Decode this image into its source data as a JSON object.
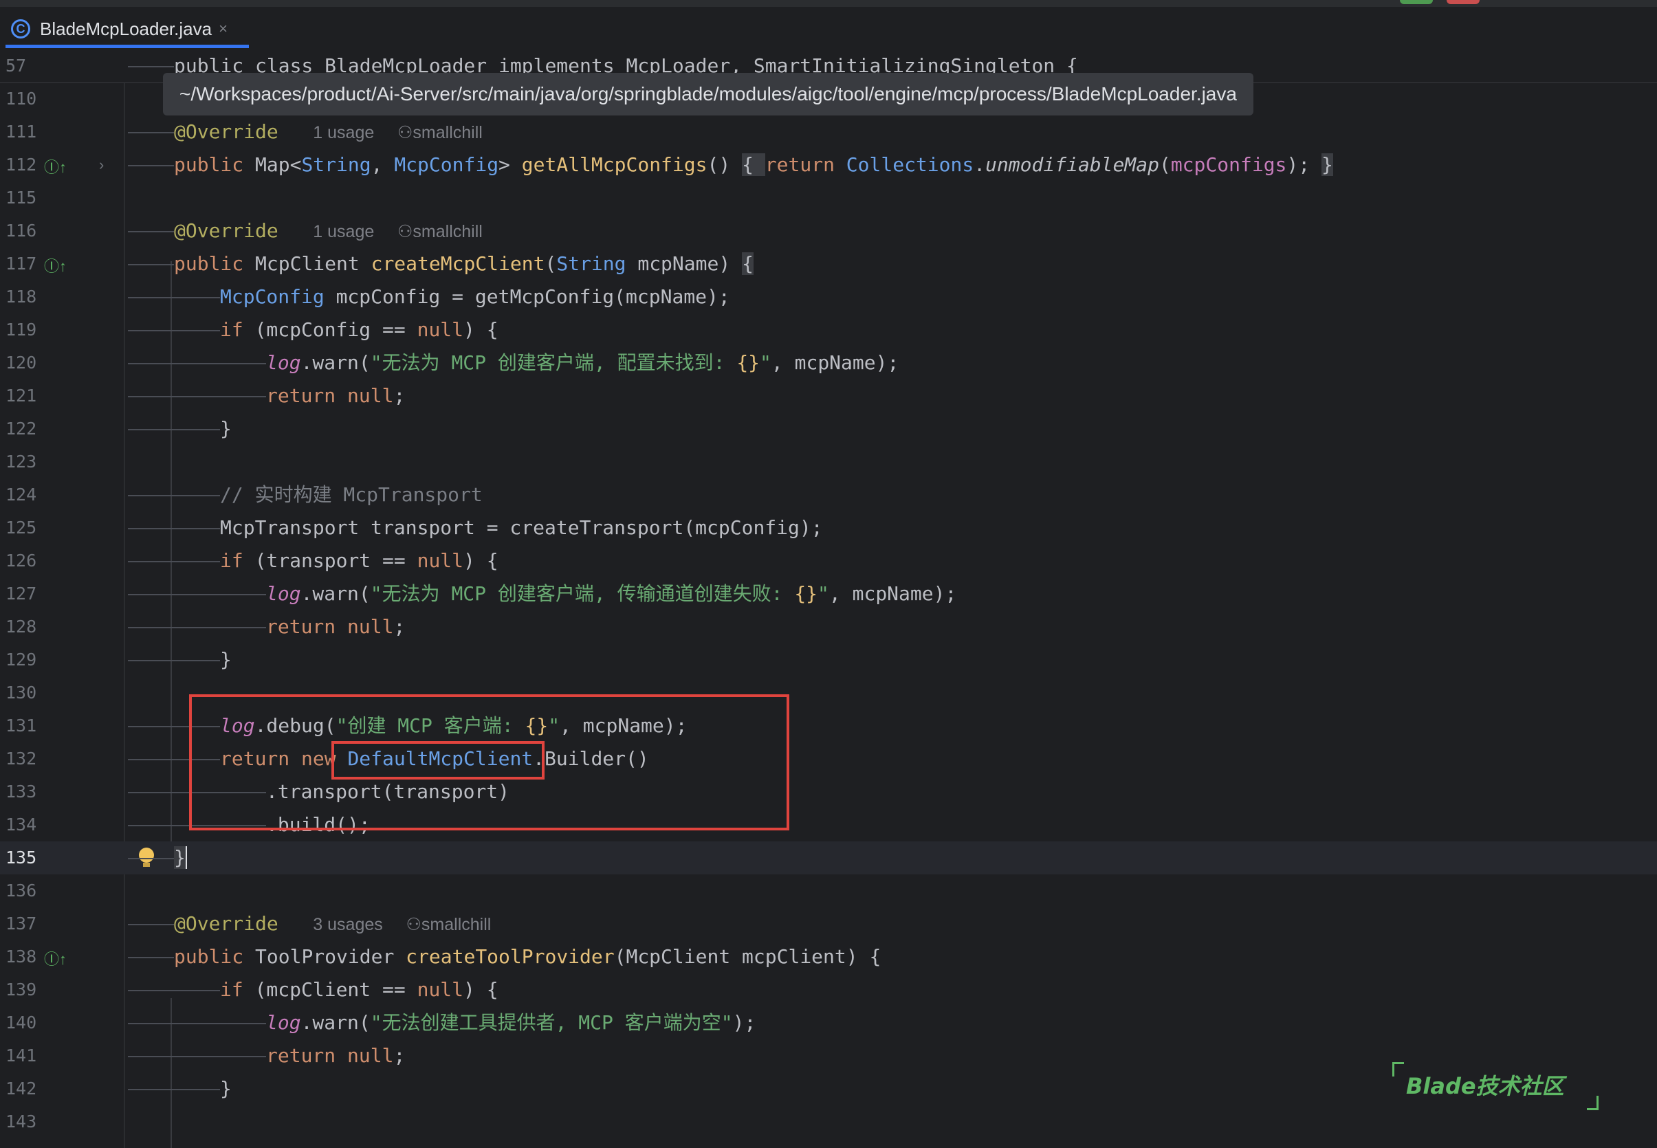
{
  "tab": {
    "icon": "C",
    "filename": "BladeMcpLoader.java",
    "close": "×"
  },
  "tooltip": {
    "path": "~/Workspaces/product/Ai-Server/src/main/java/org/springblade/modules/aigc/tool/engine/mcp/process/BladeMcpLoader.java"
  },
  "sticky": {
    "line_number": "57",
    "code": "public class BladeMcpLoader implements McpLoader, SmartInitializingSingleton {"
  },
  "hints": {
    "override_1": "@Override",
    "usage_1": "1 usage",
    "author_1": "smallchill",
    "override_2": "@Override",
    "usage_2": "1 usage",
    "author_2": "smallchill",
    "override_3": "@Override",
    "usage_3": "3 usages",
    "author_3": "smallchill"
  },
  "lines": [
    {
      "n": "110"
    },
    {
      "n": "111"
    },
    {
      "n": "112"
    },
    {
      "n": "115"
    },
    {
      "n": "116"
    },
    {
      "n": "117"
    },
    {
      "n": "118"
    },
    {
      "n": "119"
    },
    {
      "n": "120"
    },
    {
      "n": "121"
    },
    {
      "n": "122"
    },
    {
      "n": "123"
    },
    {
      "n": "124"
    },
    {
      "n": "125"
    },
    {
      "n": "126"
    },
    {
      "n": "127"
    },
    {
      "n": "128"
    },
    {
      "n": "129"
    },
    {
      "n": "130"
    },
    {
      "n": "131"
    },
    {
      "n": "132"
    },
    {
      "n": "133"
    },
    {
      "n": "134"
    },
    {
      "n": "135"
    },
    {
      "n": "136"
    },
    {
      "n": "137"
    },
    {
      "n": "138"
    },
    {
      "n": "139"
    },
    {
      "n": "140"
    },
    {
      "n": "141"
    },
    {
      "n": "142"
    },
    {
      "n": "143"
    }
  ],
  "code": {
    "l112": {
      "kw_public": "public",
      "type": " Map<",
      "t1": "String",
      "c": ", ",
      "t2": "McpConfig",
      "gt": "> ",
      "fn": "getAllMcpConfigs",
      "paren": "() ",
      "ob": "{ ",
      "ret": "return ",
      "cls": "Collections",
      "dot": ".",
      "m": "unmodifiableMap",
      "po": "(",
      "fld": "mcpConfigs",
      "pc": "); ",
      "cb": "}"
    },
    "l117": {
      "kw_public": "public",
      "ty": " McpClient ",
      "fn": "createMcpClient",
      "po": "(",
      "t": "String",
      "rest": " mcpName) ",
      "ob": "{"
    },
    "l118": {
      "ty": "McpConfig",
      "rest": " mcpConfig = getMcpConfig(mcpName);"
    },
    "l119": {
      "kw": "if",
      "rest": " (mcpConfig == ",
      "nul": "null",
      "end": ") {"
    },
    "l120": {
      "log": "log",
      "m": ".warn(",
      "s": "\"无法为 MCP 创建客户端, 配置未找到: ",
      "ph": "{}",
      "se": "\"",
      "rest": ", mcpName);"
    },
    "l121": {
      "kw": "return",
      "sp": " ",
      "nul": "null",
      "end": ";"
    },
    "l122": {
      "cb": "}"
    },
    "l124": {
      "cm": "// 实时构建 McpTransport"
    },
    "l125": {
      "code": "McpTransport transport = createTransport(mcpConfig);"
    },
    "l126": {
      "kw": "if",
      "rest": " (transport == ",
      "nul": "null",
      "end": ") {"
    },
    "l127": {
      "log": "log",
      "m": ".warn(",
      "s": "\"无法为 MCP 创建客户端, 传输通道创建失败: ",
      "ph": "{}",
      "se": "\"",
      "rest": ", mcpName);"
    },
    "l128": {
      "kw": "return",
      "sp": " ",
      "nul": "null",
      "end": ";"
    },
    "l129": {
      "cb": "}"
    },
    "l131": {
      "log": "log",
      "m": ".debug(",
      "s": "\"创建 MCP 客户端: ",
      "ph": "{}",
      "se": "\"",
      "rest": ", mcpName);"
    },
    "l132": {
      "kw": "return new ",
      "ty": "DefaultMcpClient",
      "rest": ".Builder()"
    },
    "l133": {
      "code": ".transport(transport)"
    },
    "l134": {
      "code": ".build();"
    },
    "l135": {
      "cb": "}"
    },
    "l138": {
      "kw_public": "public",
      "ty": " ToolProvider ",
      "fn": "createToolProvider",
      "rest": "(McpClient mcpClient) {"
    },
    "l139": {
      "kw": "if",
      "rest": " (mcpClient == ",
      "nul": "null",
      "end": ") {"
    },
    "l140": {
      "log": "log",
      "m": ".warn(",
      "s": "\"无法创建工具提供者, MCP 客户端为空\"",
      "rest": ");"
    },
    "l141": {
      "kw": "return",
      "sp": " ",
      "nul": "null",
      "end": ";"
    },
    "l142": {
      "cb": "}"
    }
  },
  "watermark": {
    "text": "Blade技术社区"
  },
  "colors": {
    "accent": "#3574f0",
    "highlight_box": "#e0443e",
    "watermark": "#5fb865"
  }
}
